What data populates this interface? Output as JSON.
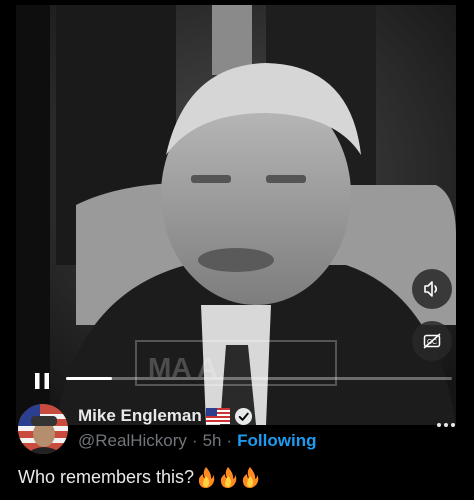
{
  "video": {
    "watermark": "MA          A",
    "progress_fraction": 0.12,
    "state": "playing",
    "controls": {
      "volume_icon": "speaker-icon",
      "captions_icon": "captions-off-icon",
      "pause_icon": "pause-icon"
    }
  },
  "post": {
    "author_name": "Mike Engleman",
    "flag_icon": "us-flag-icon",
    "verified_icon": "verified-badge-icon",
    "handle": "@RealHickory",
    "separator": "·",
    "time": "5h",
    "follow_state": "Following",
    "more_icon": "more-options-icon",
    "text": "Who remembers this?",
    "emojis": [
      "fire",
      "fire",
      "fire"
    ]
  },
  "colors": {
    "accent": "#1d9bf0",
    "secondary_text": "#71767b",
    "primary_text": "#e7e9ea"
  }
}
